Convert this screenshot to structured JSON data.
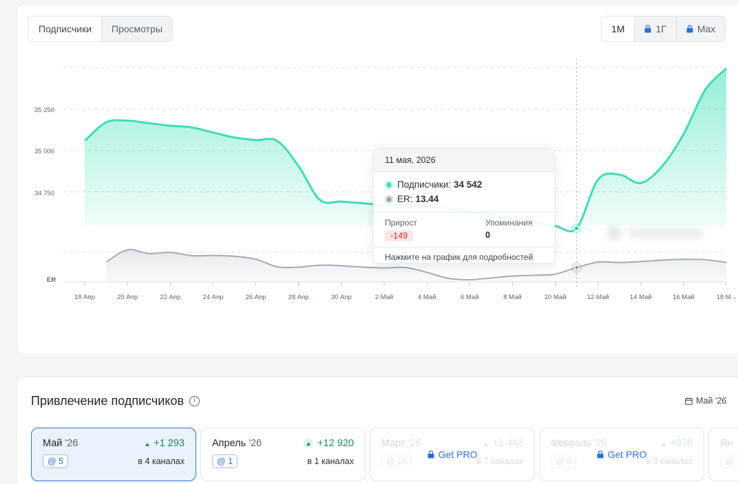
{
  "tabs": {
    "subscribers": "Подписчики",
    "views": "Просмотры"
  },
  "periods": {
    "m1": "1М",
    "y1": "1Г",
    "max": "Max"
  },
  "colors": {
    "accent": "#40e0b8",
    "er": "#9aa1aa",
    "link": "#2a6fd6"
  },
  "chart_data": {
    "type": "line",
    "x": [
      "18 Апр",
      "19 Апр",
      "20 Апр",
      "21 Апр",
      "22 Апр",
      "23 Апр",
      "24 Апр",
      "25 Апр",
      "26 Апр",
      "27 Апр",
      "28 Апр",
      "29 Апр",
      "30 Апр",
      "1 Май",
      "2 Май",
      "3 Май",
      "4 Май",
      "5 Май",
      "6 Май",
      "7 Май",
      "8 Май",
      "9 Май",
      "10 Май",
      "11 Май",
      "12 Май",
      "13 Май",
      "14 Май",
      "15 Май",
      "16 Май",
      "17 Май",
      "18 Май"
    ],
    "tick_labels": [
      "18 Апр",
      "20 Апр",
      "22 Апр",
      "24 Апр",
      "26 Апр",
      "28 Апр",
      "30 Апр",
      "2 Май",
      "4 Май",
      "6 Май",
      "8 Май",
      "10 Май",
      "12 Май",
      "14 Май",
      "16 Май",
      "18 М..."
    ],
    "y_ticks": [
      "35 250",
      "35 000",
      "34 750"
    ],
    "er_label": "ER",
    "ylim": [
      34550,
      35500
    ],
    "series": [
      {
        "name": "Подписчики",
        "values": [
          35060,
          35170,
          35180,
          35165,
          35150,
          35140,
          35110,
          35080,
          35065,
          35060,
          34910,
          34710,
          34700,
          34690,
          34680,
          34680,
          34670,
          34660,
          34640,
          34620,
          34600,
          34575,
          34555,
          34542,
          34830,
          34860,
          34810,
          34910,
          35100,
          35360,
          35490
        ]
      },
      {
        "name": "ER",
        "values": [
          null,
          13.72,
          14.35,
          14.16,
          14.22,
          14.05,
          14.06,
          14.02,
          13.87,
          13.48,
          13.46,
          13.56,
          13.53,
          13.46,
          13.42,
          13.44,
          13.19,
          12.88,
          12.81,
          12.9,
          13.0,
          13.04,
          13.1,
          13.44,
          13.72,
          13.7,
          13.75,
          13.82,
          13.86,
          13.84,
          13.7
        ]
      }
    ]
  },
  "tooltip": {
    "date": "11 мая, 2026",
    "subs_label": "Подписчики:",
    "subs_value": "34 542",
    "er_label": "ER:",
    "er_value": "13.44",
    "growth_label": "Прирост",
    "growth_value": "-149",
    "mentions_label": "Упоминания",
    "mentions_value": "0",
    "footer": "Нажмите на график для подробностей"
  },
  "attraction": {
    "title": "Привлечение подписчиков",
    "info": "i",
    "month_selector": "Май '26",
    "cards": [
      {
        "month": "Май",
        "year": "'26",
        "delta": "+1 293",
        "mentions": "@ 5",
        "channels": "в 4 каналах",
        "active": true,
        "locked": false
      },
      {
        "month": "Апрель",
        "year": "'26",
        "delta": "+12 920",
        "mentions": "@ 1",
        "channels": "в 1 каналах",
        "active": false,
        "locked": false
      },
      {
        "month": "Март",
        "year": "'26",
        "delta": "+1 443",
        "mentions": "@ 18",
        "channels": "в 7 каналах",
        "active": false,
        "locked": true
      },
      {
        "month": "Февраль",
        "year": "'26",
        "delta": "+976",
        "mentions": "@ 8",
        "channels": "в 3 каналах",
        "active": false,
        "locked": true
      },
      {
        "month": "Ян",
        "year": "",
        "delta": "",
        "mentions": "@",
        "channels": "",
        "active": false,
        "locked": true
      }
    ],
    "pro_label": "Get PRO"
  }
}
